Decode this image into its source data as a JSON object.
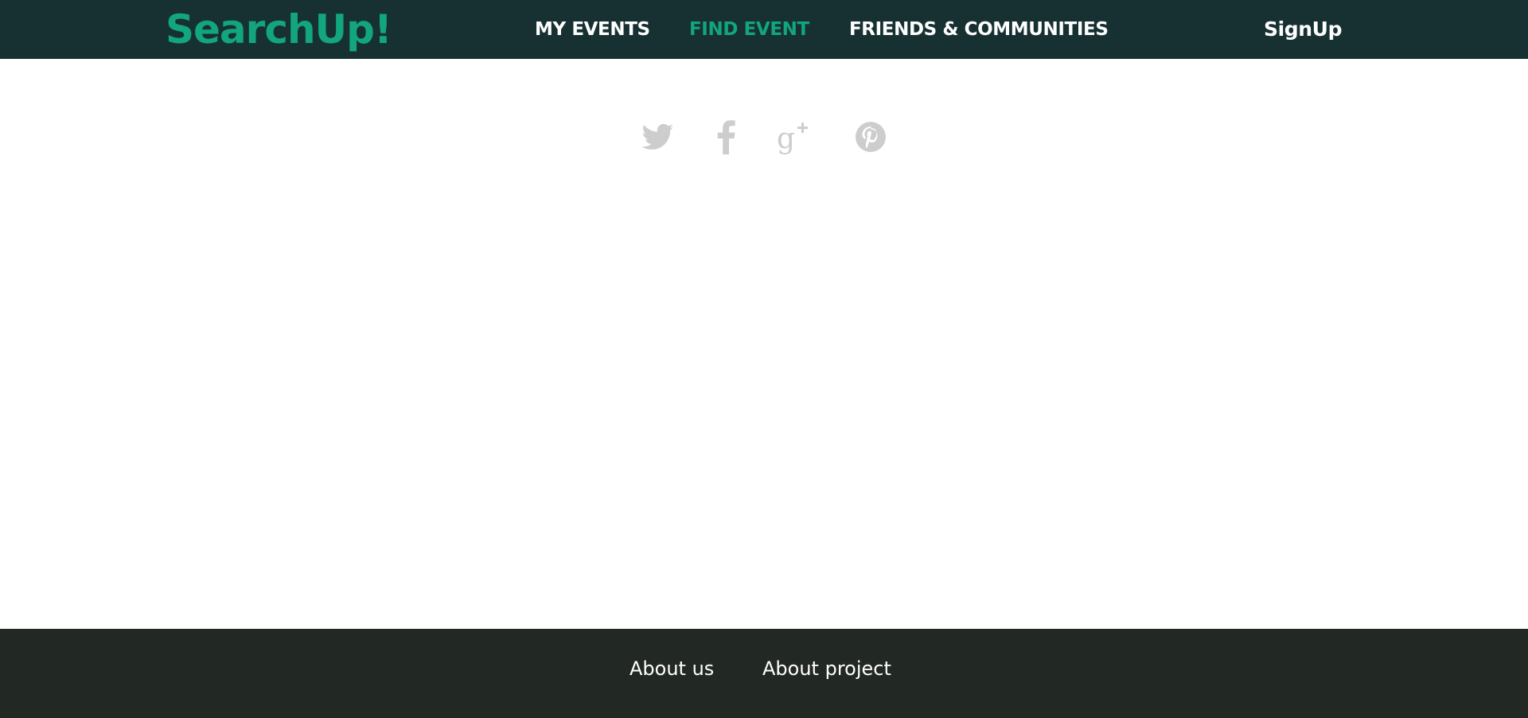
{
  "header": {
    "logo": "SearchUp!",
    "nav": {
      "my_events": "MY EVENTS",
      "find_event": "FIND EVENT",
      "friends_communities": "FRIENDS & COMMUNITIES"
    },
    "signup": "SignUp"
  },
  "social_icons": [
    "twitter-icon",
    "facebook-icon",
    "google-plus-icon",
    "pinterest-icon"
  ],
  "footer": {
    "about_us": "About us",
    "about_project": "About project"
  },
  "colors": {
    "header_bg": "#173133",
    "accent": "#12a57e",
    "footer_bg": "#222823",
    "icon_gray": "#cdcdcd"
  }
}
